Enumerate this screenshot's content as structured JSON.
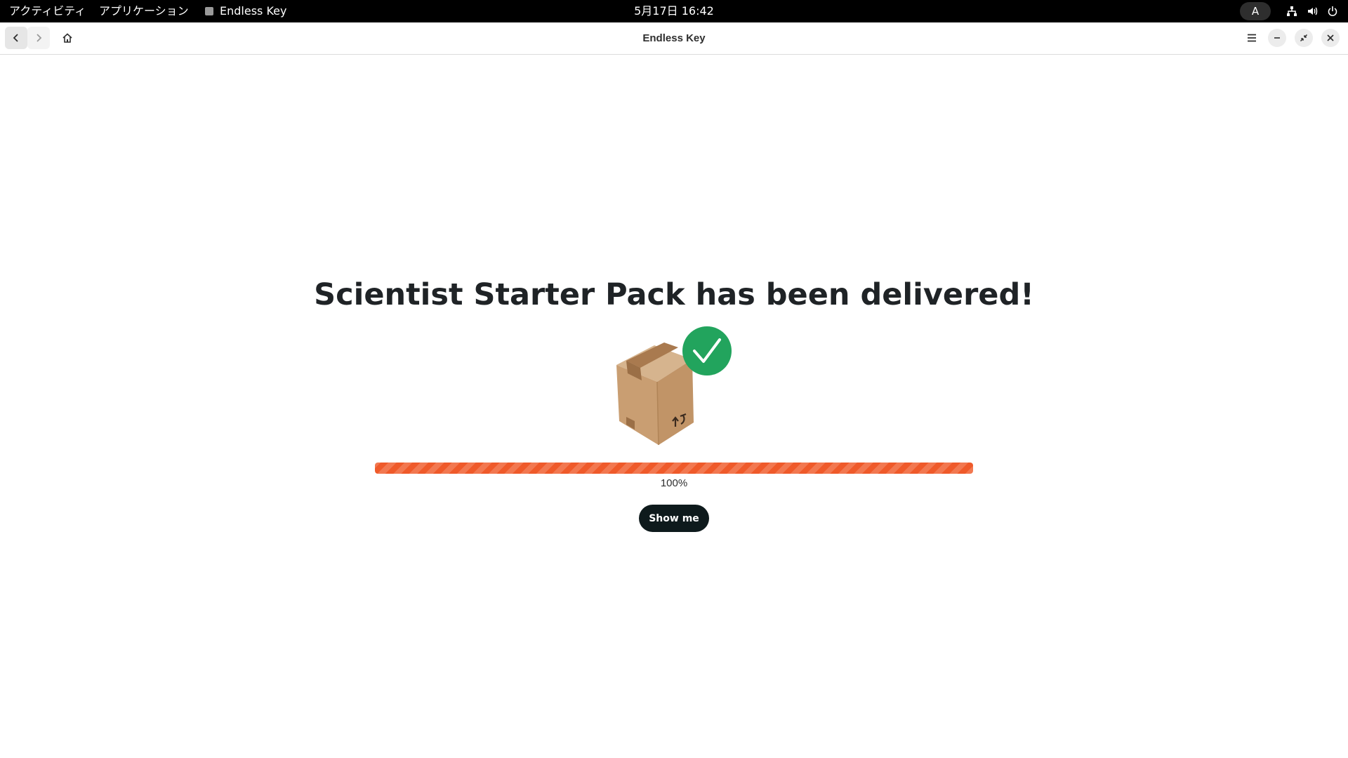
{
  "topbar": {
    "activities": "アクティビティ",
    "applications": "アプリケーション",
    "window_title": "Endless Key",
    "clock": "5月17日  16:42",
    "input_method": "A",
    "icons": [
      "network-icon",
      "volume-icon",
      "power-icon"
    ]
  },
  "headerbar": {
    "title": "Endless Key",
    "buttons": [
      "back-icon",
      "forward-icon",
      "home-icon",
      "menu-icon",
      "minimize-icon",
      "restore-icon",
      "close-icon"
    ]
  },
  "main": {
    "headline": "Scientist Starter Pack has been delivered!",
    "progress": {
      "value": 100,
      "label": "100%"
    },
    "action_label": "Show me",
    "illustration": "delivered-box-with-checkmark"
  },
  "colors": {
    "progress": "#ef5a2a",
    "check_circle": "#22a45d",
    "button": "#0e1a1c",
    "box": "#c9a27a"
  }
}
